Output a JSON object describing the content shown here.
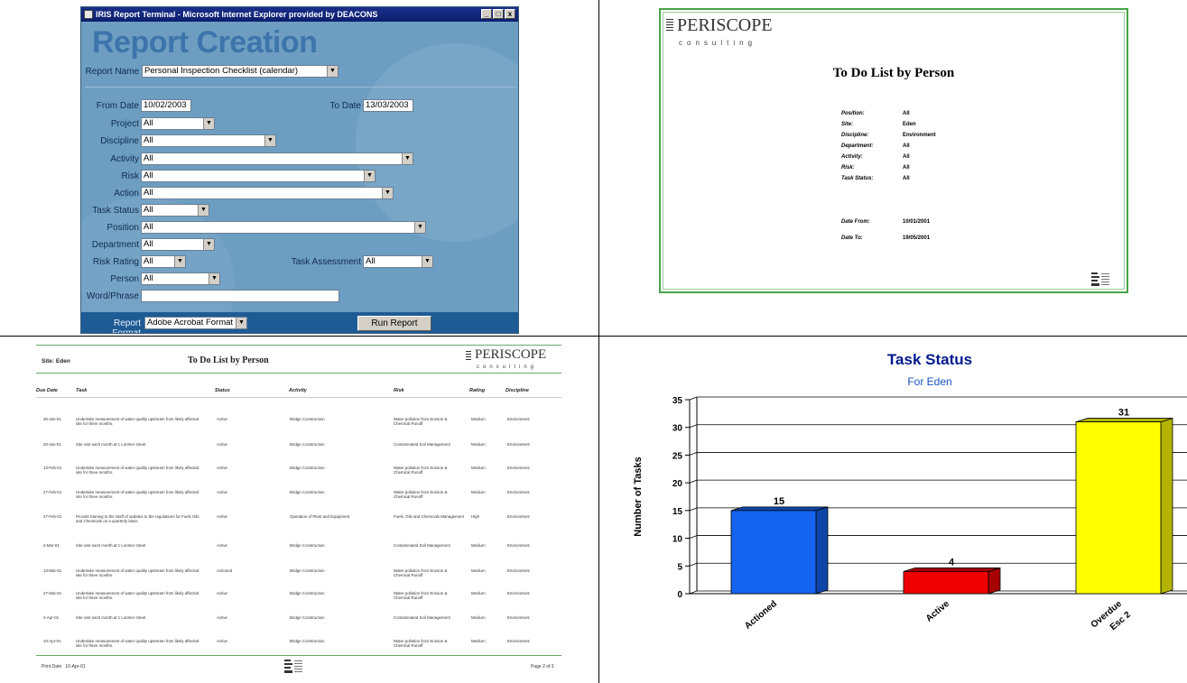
{
  "ie_window": {
    "title": "IRIS Report Terminal - Microsoft Internet Explorer provided by DEACONS",
    "min": "_",
    "max": "□",
    "close": "x"
  },
  "report_form": {
    "heading": "Report Creation",
    "report_name_label": "Report Name",
    "report_name_value": "Personal Inspection Checklist (calendar)",
    "from_date_label": "From Date",
    "from_date_value": "10/02/2003",
    "to_date_label": "To Date",
    "to_date_value": "13/03/2003",
    "project_label": "Project",
    "project_value": "All",
    "discipline_label": "Discipline",
    "discipline_value": "All",
    "activity_label": "Activity",
    "activity_value": "All",
    "risk_label": "Risk",
    "risk_value": "All",
    "action_label": "Action",
    "action_value": "All",
    "task_status_label": "Task Status",
    "task_status_value": "All",
    "position_label": "Position",
    "position_value": "All",
    "department_label": "Department",
    "department_value": "All",
    "risk_rating_label": "Risk Rating",
    "risk_rating_value": "All",
    "task_assessment_label": "Task Assessment",
    "task_assessment_value": "All",
    "person_label": "Person",
    "person_value": "All",
    "word_phrase_label": "Word/Phrase",
    "word_phrase_value": "",
    "report_format_label": "Report Format",
    "report_format_value": "Adobe Acrobat Format",
    "run_report_label": "Run Report"
  },
  "cover_page": {
    "logo_text": "PERISCOPE",
    "logo_sub": "consulting",
    "title": "To Do List by Person",
    "fields": [
      {
        "key": "Position:",
        "value": "All"
      },
      {
        "key": "Site:",
        "value": "Eden"
      },
      {
        "key": "Discipline:",
        "value": "Environment"
      },
      {
        "key": "Department:",
        "value": "All"
      },
      {
        "key": "Activity:",
        "value": "All"
      },
      {
        "key": "Risk:",
        "value": "All"
      },
      {
        "key": "Task Status:",
        "value": "All"
      }
    ],
    "date_from_key": "Date From:",
    "date_from_value": "10/01/2001",
    "date_to_key": "Date To:",
    "date_to_value": "19/05/2001"
  },
  "todo_report": {
    "site_label": "Site:",
    "site_value": "Eden",
    "title": "To Do List by Person",
    "logo_text": "PERISCOPE",
    "logo_sub": "consulting",
    "headers": [
      "Due Date",
      "Task",
      "Status",
      "Activity",
      "Risk",
      "Rating",
      "Discipline"
    ],
    "rows": [
      {
        "date": "30-Jan-01",
        "task": "Undertake measurement of water quality upstream from likely affected site for three months.",
        "status": "Active",
        "activity": "Bridge Construction",
        "risk": "Water pollution from Erosion & Chemical Runoff",
        "rating": "Medium",
        "discipline": "Environment"
      },
      {
        "date": "30-Jan-01",
        "task": "Site visit each month at 1 Lorimer street",
        "status": "Active",
        "activity": "Bridge Construction",
        "risk": "Contaminated Soil Management",
        "rating": "Medium",
        "discipline": "Environment"
      },
      {
        "date": "13-Feb-01",
        "task": "Undertake measurement of water quality upstream from likely affected site for three months.",
        "status": "Active",
        "activity": "Bridge Construction",
        "risk": "Water pollution from Erosion & Chemical Runoff",
        "rating": "Medium",
        "discipline": "Environment"
      },
      {
        "date": "27-Feb-01",
        "task": "Undertake measurement of water quality upstream from likely affected site for three months.",
        "status": "Active",
        "activity": "Bridge Construction",
        "risk": "Water pollution from Erosion & Chemical Runoff",
        "rating": "Medium",
        "discipline": "Environment"
      },
      {
        "date": "27-Feb-01",
        "task": "Provide training to the Staff of updates to the regulations for Fuels Oils and Chemicals on a quarterly basis",
        "status": "Active",
        "activity": "Operation of Plant and Equipment",
        "risk": "Fuels, Oils and Chemicals Management",
        "rating": "High",
        "discipline": "Environment"
      },
      {
        "date": "2-Mar-01",
        "task": "Site visit each month at 1 Lorimer street",
        "status": "Active",
        "activity": "Bridge Construction",
        "risk": "Contaminated Soil Management",
        "rating": "Medium",
        "discipline": "Environment"
      },
      {
        "date": "13-Mar-01",
        "task": "Undertake measurement of water quality upstream from likely affected site for three months.",
        "status": "Actioned",
        "activity": "Bridge Construction",
        "risk": "Water pollution from Erosion & Chemical Runoff",
        "rating": "Medium",
        "discipline": "Environment"
      },
      {
        "date": "27-Mar-01",
        "task": "Undertake measurement of water quality upstream from likely affected site for three months.",
        "status": "Active",
        "activity": "Bridge Construction",
        "risk": "Water pollution from Erosion & Chemical Runoff",
        "rating": "Medium",
        "discipline": "Environment"
      },
      {
        "date": "2-Apr-01",
        "task": "Site visit each month at 1 Lorimer street",
        "status": "Active",
        "activity": "Bridge Construction",
        "risk": "Contaminated Soil Management",
        "rating": "Medium",
        "discipline": "Environment"
      },
      {
        "date": "10-Apr-01",
        "task": "Undertake measurement of water quality upstream from likely affected site for three months.",
        "status": "Active",
        "activity": "Bridge Construction",
        "risk": "Water pollution from Erosion & Chemical Runoff",
        "rating": "Medium",
        "discipline": "Environment"
      }
    ],
    "print_date_label": "Print Date",
    "print_date_value": "10-Apr-01",
    "page_label": "Page 2 of 3"
  },
  "chart_data": {
    "type": "bar",
    "title": "Task Status",
    "subtitle": "For Eden",
    "ylabel": "Number of Tasks",
    "xlabel": "",
    "categories": [
      "Actioned",
      "Active",
      "Overdue Esc 2"
    ],
    "values": [
      15,
      4,
      31
    ],
    "ylim": [
      0,
      35
    ],
    "yticks": [
      0,
      5,
      10,
      15,
      20,
      25,
      30,
      35
    ],
    "colors": [
      "#1464f0",
      "#ee0000",
      "#ffff00"
    ],
    "grid": true,
    "legend": "none"
  }
}
